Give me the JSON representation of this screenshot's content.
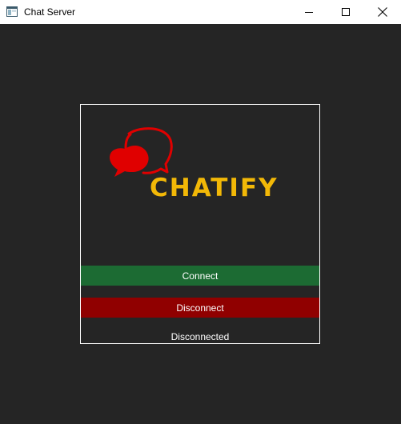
{
  "window": {
    "title": "Chat Server",
    "app_icon": "window-app-icon",
    "controls": {
      "minimize_icon": "minimize-icon",
      "maximize_icon": "maximize-icon",
      "close_icon": "close-icon"
    }
  },
  "logo": {
    "text": "CHATIFY",
    "icon": "chat-bubbles-icon",
    "text_color": "#f2b807",
    "icon_color": "#e00000"
  },
  "buttons": {
    "connect_label": "Connect",
    "disconnect_label": "Disconnect",
    "connect_color": "#1c6b33",
    "disconnect_color": "#900000"
  },
  "status": {
    "text": "Disconnected"
  },
  "colors": {
    "background": "#252525",
    "titlebar": "#ffffff",
    "panel_border": "#ffffff"
  }
}
